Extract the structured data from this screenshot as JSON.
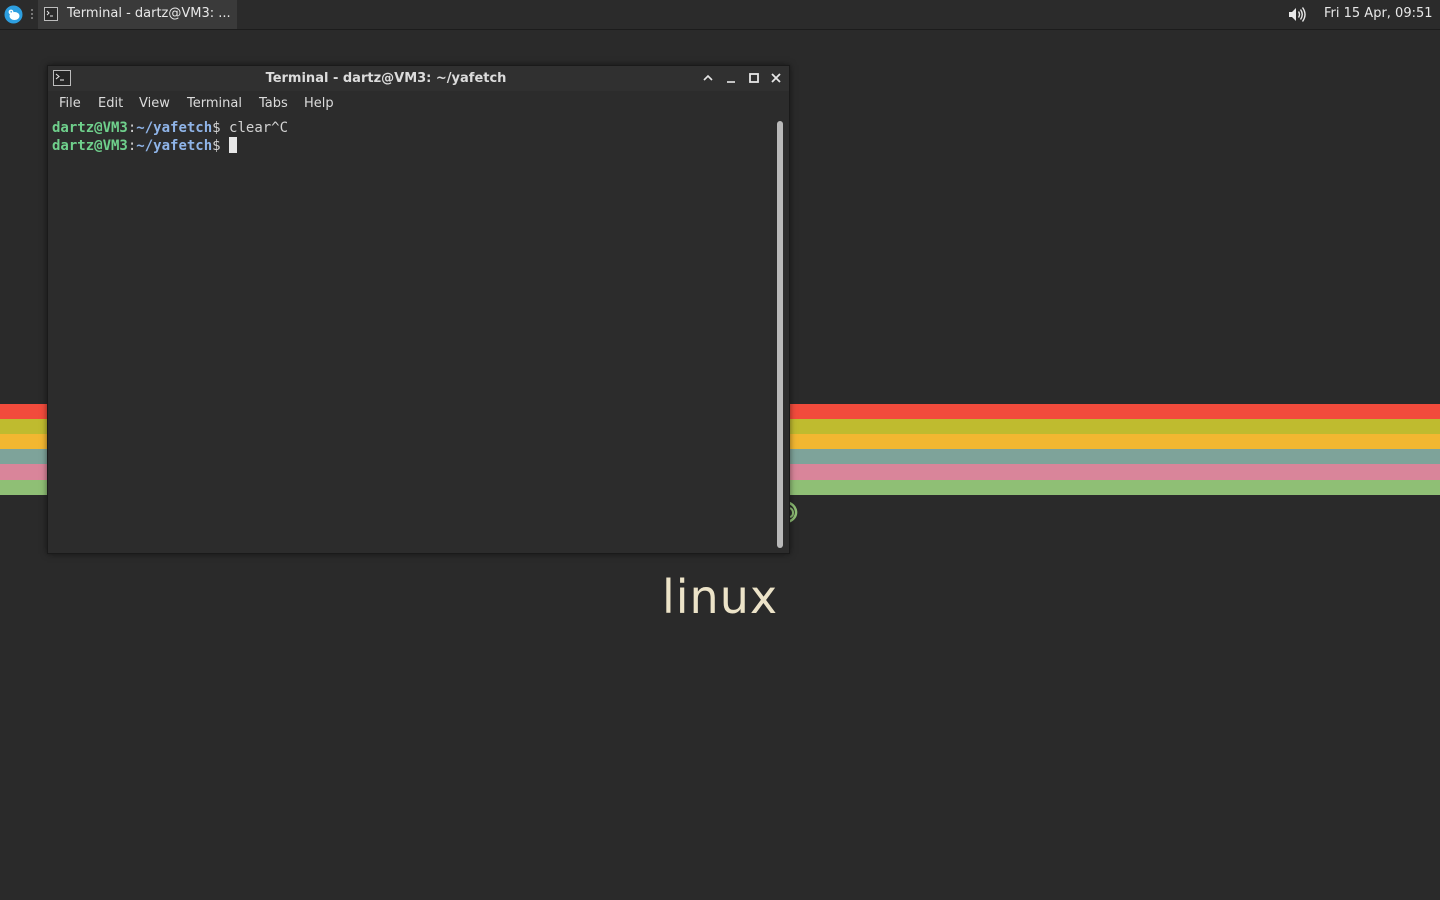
{
  "panel": {
    "task_title": "Terminal - dartz@VM3: ...",
    "clock": "Fri 15 Apr, 09:51"
  },
  "window": {
    "title": "Terminal - dartz@VM3: ~/yafetch",
    "menu": [
      "File",
      "Edit",
      "View",
      "Terminal",
      "Tabs",
      "Help"
    ]
  },
  "terminal": {
    "lines": [
      {
        "user_host": "dartz@VM3",
        "colon": ":",
        "path": "~/yafetch",
        "dollar": "$",
        "command": "clear^C"
      },
      {
        "user_host": "dartz@VM3",
        "colon": ":",
        "path": "~/yafetch",
        "dollar": "$",
        "command": ""
      }
    ]
  },
  "wallpaper": {
    "logo_text": "linux",
    "stripe_colors": [
      "#f24b3c",
      "#bfbb2f",
      "#f2b731",
      "#7ea39a",
      "#d9859a",
      "#8fbf75"
    ]
  },
  "icons": {
    "menu": "xfce-mouse-icon",
    "terminal": "terminal-icon",
    "volume": "volume-icon",
    "window_controls": [
      "shade-icon",
      "minimize-icon",
      "maximize-icon",
      "close-icon"
    ]
  }
}
